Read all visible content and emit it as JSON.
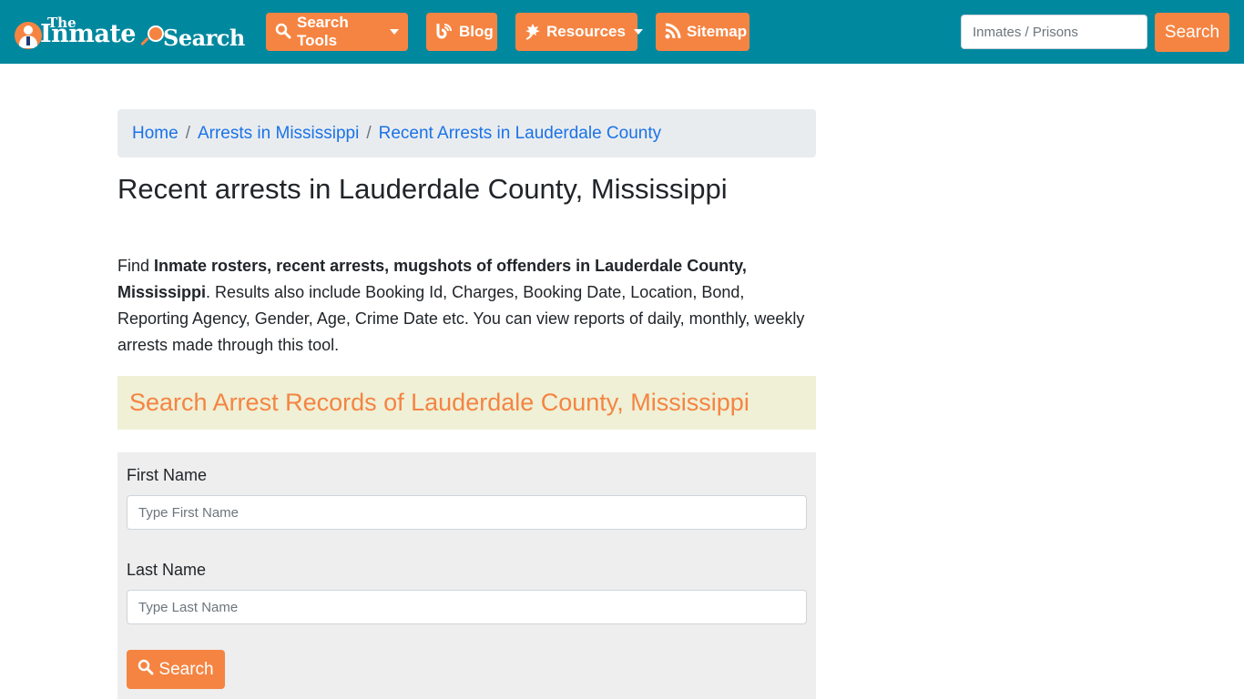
{
  "navbar": {
    "logo": {
      "the": "The",
      "inmate": "Inmate",
      "search": "Search"
    },
    "menu": [
      {
        "label": "Search Tools",
        "icon": "search-icon",
        "icon_glyph": "🔍",
        "dropdown": true
      },
      {
        "label": "Blog",
        "icon": "blog-icon",
        "icon_glyph": "ᵇ",
        "dropdown": false
      },
      {
        "label": "Resources",
        "icon": "leaf-icon",
        "icon_glyph": "❦",
        "dropdown": true
      },
      {
        "label": "Sitemap",
        "icon": "rss-icon",
        "icon_glyph": "◔",
        "dropdown": false
      }
    ],
    "search": {
      "placeholder": "Inmates / Prisons",
      "value": "",
      "button_label": "Search"
    }
  },
  "breadcrumb": [
    {
      "label": "Home"
    },
    {
      "label": "Arrests in Mississippi"
    },
    {
      "label": "Recent Arrests in Lauderdale County"
    }
  ],
  "breadcrumb_separator": "/",
  "page_title": "Recent arrests in Lauderdale County, Mississippi",
  "intro": {
    "prefix": "Find ",
    "bold": "Inmate rosters, recent arrests, mugshots of offenders in Lauderdale County, Mississippi",
    "suffix": ". Results also include Booking Id, Charges, Booking Date, Location, Bond, Reporting Agency, Gender, Age, Crime Date etc. You can view reports of daily, monthly, weekly arrests made through this tool."
  },
  "search_section": {
    "heading": "Search Arrest Records of Lauderdale County, Mississippi",
    "first_name": {
      "label": "First Name",
      "placeholder": "Type First Name",
      "value": ""
    },
    "last_name": {
      "label": "Last Name",
      "placeholder": "Type Last Name",
      "value": ""
    },
    "button_label": "Search"
  },
  "colors": {
    "navbar_bg": "#00889f",
    "accent_orange": "#f58442",
    "link_blue": "#1a73e8",
    "breadcrumb_bg": "#e9ecef",
    "banner_bg": "#eff0d6",
    "form_bg": "#eeeeee"
  }
}
